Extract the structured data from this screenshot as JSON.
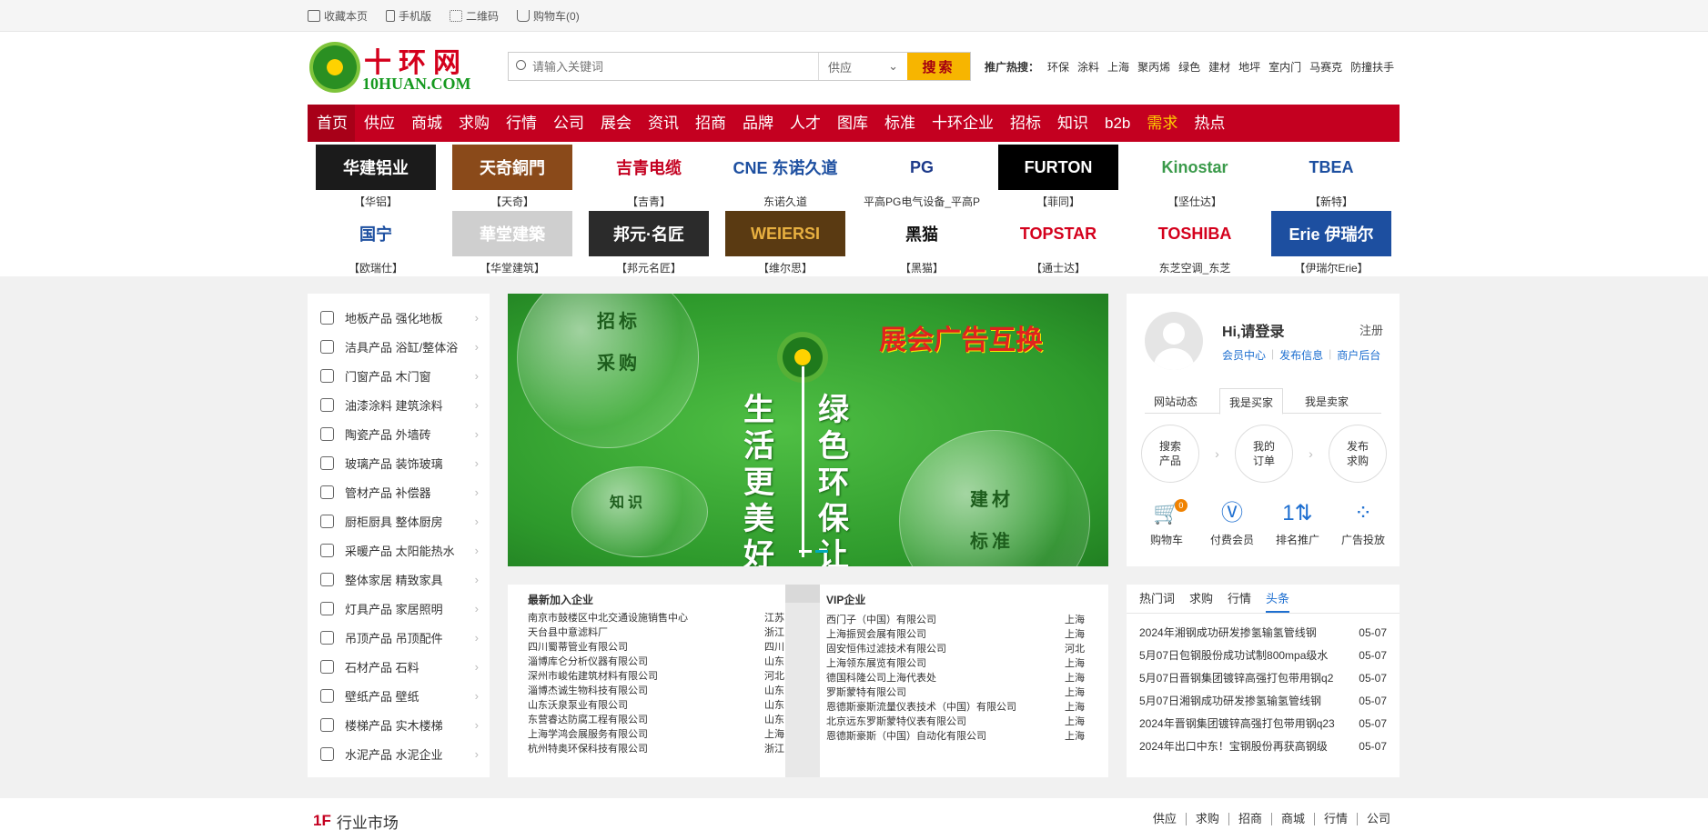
{
  "topbar": {
    "items": [
      "收藏本页",
      "手机版",
      "二维码",
      "购物车(0)"
    ]
  },
  "header": {
    "logo_cn": "十环网",
    "logo_en": "10HUAN.COM",
    "search_placeholder": "请输入关键词",
    "search_type": "供应",
    "search_button": "搜索",
    "hot_label": "推广热搜：",
    "hot_words": [
      "环保",
      "涂料",
      "上海",
      "聚丙烯",
      "绿色",
      "建材",
      "地坪",
      "室内门",
      "马赛克",
      "防撞扶手"
    ]
  },
  "nav": {
    "items": [
      "首页",
      "供应",
      "商城",
      "求购",
      "行情",
      "公司",
      "展会",
      "资讯",
      "招商",
      "品牌",
      "人才",
      "图库",
      "标准",
      "十环企业",
      "招标",
      "知识",
      "b2b",
      "需求",
      "热点"
    ]
  },
  "brands": {
    "items": [
      {
        "logo": "华建铝业",
        "caption": "【华铝】",
        "bg": "#1b1b1b",
        "fg": "#ffffff"
      },
      {
        "logo": "天奇銅門",
        "caption": "【天奇】",
        "bg": "#8a4a1a",
        "fg": "#ffffff"
      },
      {
        "logo": "吉青电缆",
        "caption": "【吉青】",
        "bg": "#ffffff",
        "fg": "#c40020"
      },
      {
        "logo": "CNE 东诺久道",
        "caption": "东诺久道",
        "bg": "#ffffff",
        "fg": "#1d4fa0"
      },
      {
        "logo": "PG",
        "caption": "平高PG电气设备_平高P",
        "bg": "#ffffff",
        "fg": "#1d3a8a"
      },
      {
        "logo": "FURTON",
        "caption": "【菲同】",
        "bg": "#000000",
        "fg": "#ffffff"
      },
      {
        "logo": "Kinostar",
        "caption": "【坚仕达】",
        "bg": "#ffffff",
        "fg": "#3a9a4a"
      },
      {
        "logo": "TBEA",
        "caption": "【新特】",
        "bg": "#ffffff",
        "fg": "#1d4fa0"
      },
      {
        "logo": "国宁",
        "caption": "【欧瑞仕】",
        "bg": "#ffffff",
        "fg": "#1d4fa0"
      },
      {
        "logo": "華堂建築",
        "caption": "【华堂建筑】",
        "bg": "#cfcfcf",
        "fg": "#ffffff"
      },
      {
        "logo": "邦元·名匠",
        "caption": "【邦元名匠】",
        "bg": "#2b2b2b",
        "fg": "#ffffff"
      },
      {
        "logo": "WEIERSI",
        "caption": "【维尔思】",
        "bg": "#5a3a12",
        "fg": "#e8b040"
      },
      {
        "logo": "黑猫",
        "caption": "【黑猫】",
        "bg": "#ffffff",
        "fg": "#111111"
      },
      {
        "logo": "TOPSTAR",
        "caption": "【通士达】",
        "bg": "#ffffff",
        "fg": "#d4001c"
      },
      {
        "logo": "TOSHIBA",
        "caption": "东芝空调_东芝",
        "bg": "#ffffff",
        "fg": "#d4001c"
      },
      {
        "logo": "Erie 伊瑞尔",
        "caption": "【伊瑞尔Erie】",
        "bg": "#1d4fa0",
        "fg": "#ffffff"
      }
    ]
  },
  "categories": [
    "地板产品 强化地板",
    "洁具产品 浴缸/整体浴",
    "门窗产品 木门窗",
    "油漆涂料 建筑涂料",
    "陶瓷产品 外墙砖",
    "玻璃产品 装饰玻璃",
    "管材产品 补偿器",
    "厨柜厨具 整体厨房",
    "采暖产品 太阳能热水",
    "整体家居 精致家具",
    "灯具产品 家居照明",
    "吊顶产品 吊顶配件",
    "石材产品 石料",
    "壁纸产品 壁纸",
    "楼梯产品 实木楼梯",
    "水泥产品 水泥企业"
  ],
  "banner": {
    "headline": "展会广告互换",
    "left_col": "生活更美好",
    "right_col": "绿色环保让",
    "words": [
      "招标",
      "采购",
      "知识",
      "建材",
      "标准"
    ]
  },
  "news": {
    "new_title": "最新加入企业",
    "new_items": [
      {
        "name": "南京市鼓楼区中北交通设施销售中心",
        "loc": "江苏"
      },
      {
        "name": "天台县中意滤料厂",
        "loc": "浙江"
      },
      {
        "name": "四川蜀蒂管业有限公司",
        "loc": "四川"
      },
      {
        "name": "淄博库仑分析仪器有限公司",
        "loc": "山东"
      },
      {
        "name": "深州市峻佑建筑材料有限公司",
        "loc": "河北"
      },
      {
        "name": "淄博杰诚生物科技有限公司",
        "loc": "山东"
      },
      {
        "name": "山东沃泉泵业有限公司",
        "loc": "山东"
      },
      {
        "name": "东营睿达防腐工程有限公司",
        "loc": "山东"
      },
      {
        "name": "上海学鸿会展服务有限公司",
        "loc": "上海"
      },
      {
        "name": "杭州特奥环保科技有限公司",
        "loc": "浙江"
      }
    ],
    "vip_title": "VIP企业",
    "vip_items": [
      {
        "name": "西门子（中国）有限公司",
        "loc": "上海"
      },
      {
        "name": "上海振贸会展有限公司",
        "loc": "上海"
      },
      {
        "name": "固安恒伟过滤技术有限公司",
        "loc": "河北"
      },
      {
        "name": "上海领东展览有限公司",
        "loc": "上海"
      },
      {
        "name": "德国科隆公司上海代表处",
        "loc": "上海"
      },
      {
        "name": "罗斯蒙特有限公司",
        "loc": "上海"
      },
      {
        "name": "恩德斯豪斯流量仪表技术（中国）有限公司",
        "loc": "上海"
      },
      {
        "name": "北京远东罗斯蒙特仪表有限公司",
        "loc": "上海"
      },
      {
        "name": "恩德斯豪斯（中国）自动化有限公司",
        "loc": "上海"
      }
    ]
  },
  "user": {
    "greeting": "Hi,请登录",
    "register": "注册",
    "links": [
      "会员中心",
      "发布信息",
      "商户后台"
    ],
    "tabs": [
      "网站动态",
      "我是买家",
      "我是卖家"
    ],
    "circles": [
      "搜索\n产品",
      "我的\n订单",
      "发布\n求购"
    ],
    "icons": [
      {
        "icon": "cart-icon",
        "glyph": "🛒",
        "label": "购物车",
        "badge": "0"
      },
      {
        "icon": "vip-icon",
        "glyph": "Ⓥ",
        "label": "付费会员"
      },
      {
        "icon": "rank-icon",
        "glyph": "1⇅",
        "label": "排名推广"
      },
      {
        "icon": "ad-icon",
        "glyph": "⁘",
        "label": "广告投放"
      }
    ]
  },
  "hot_news": {
    "tabs": [
      "热门词",
      "求购",
      "行情",
      "头条"
    ],
    "items": [
      {
        "title": "2024年湘钢成功研发掺氢输氢管线钢",
        "date": "05-07"
      },
      {
        "title": "5月07日包钢股份成功试制800mpa级水",
        "date": "05-07"
      },
      {
        "title": "5月07日晋钢集团镀锌高强打包带用钢q2",
        "date": "05-07"
      },
      {
        "title": "5月07日湘钢成功研发掺氢输氢管线钢",
        "date": "05-07"
      },
      {
        "title": "2024年晋钢集团镀锌高强打包带用钢q23",
        "date": "05-07"
      },
      {
        "title": "2024年出口中东！宝钢股份再获高钢级",
        "date": "05-07"
      }
    ]
  },
  "floor": {
    "number": "1F",
    "title": "行业市场",
    "links": [
      "供应",
      "求购",
      "招商",
      "商城",
      "行情",
      "公司"
    ]
  }
}
